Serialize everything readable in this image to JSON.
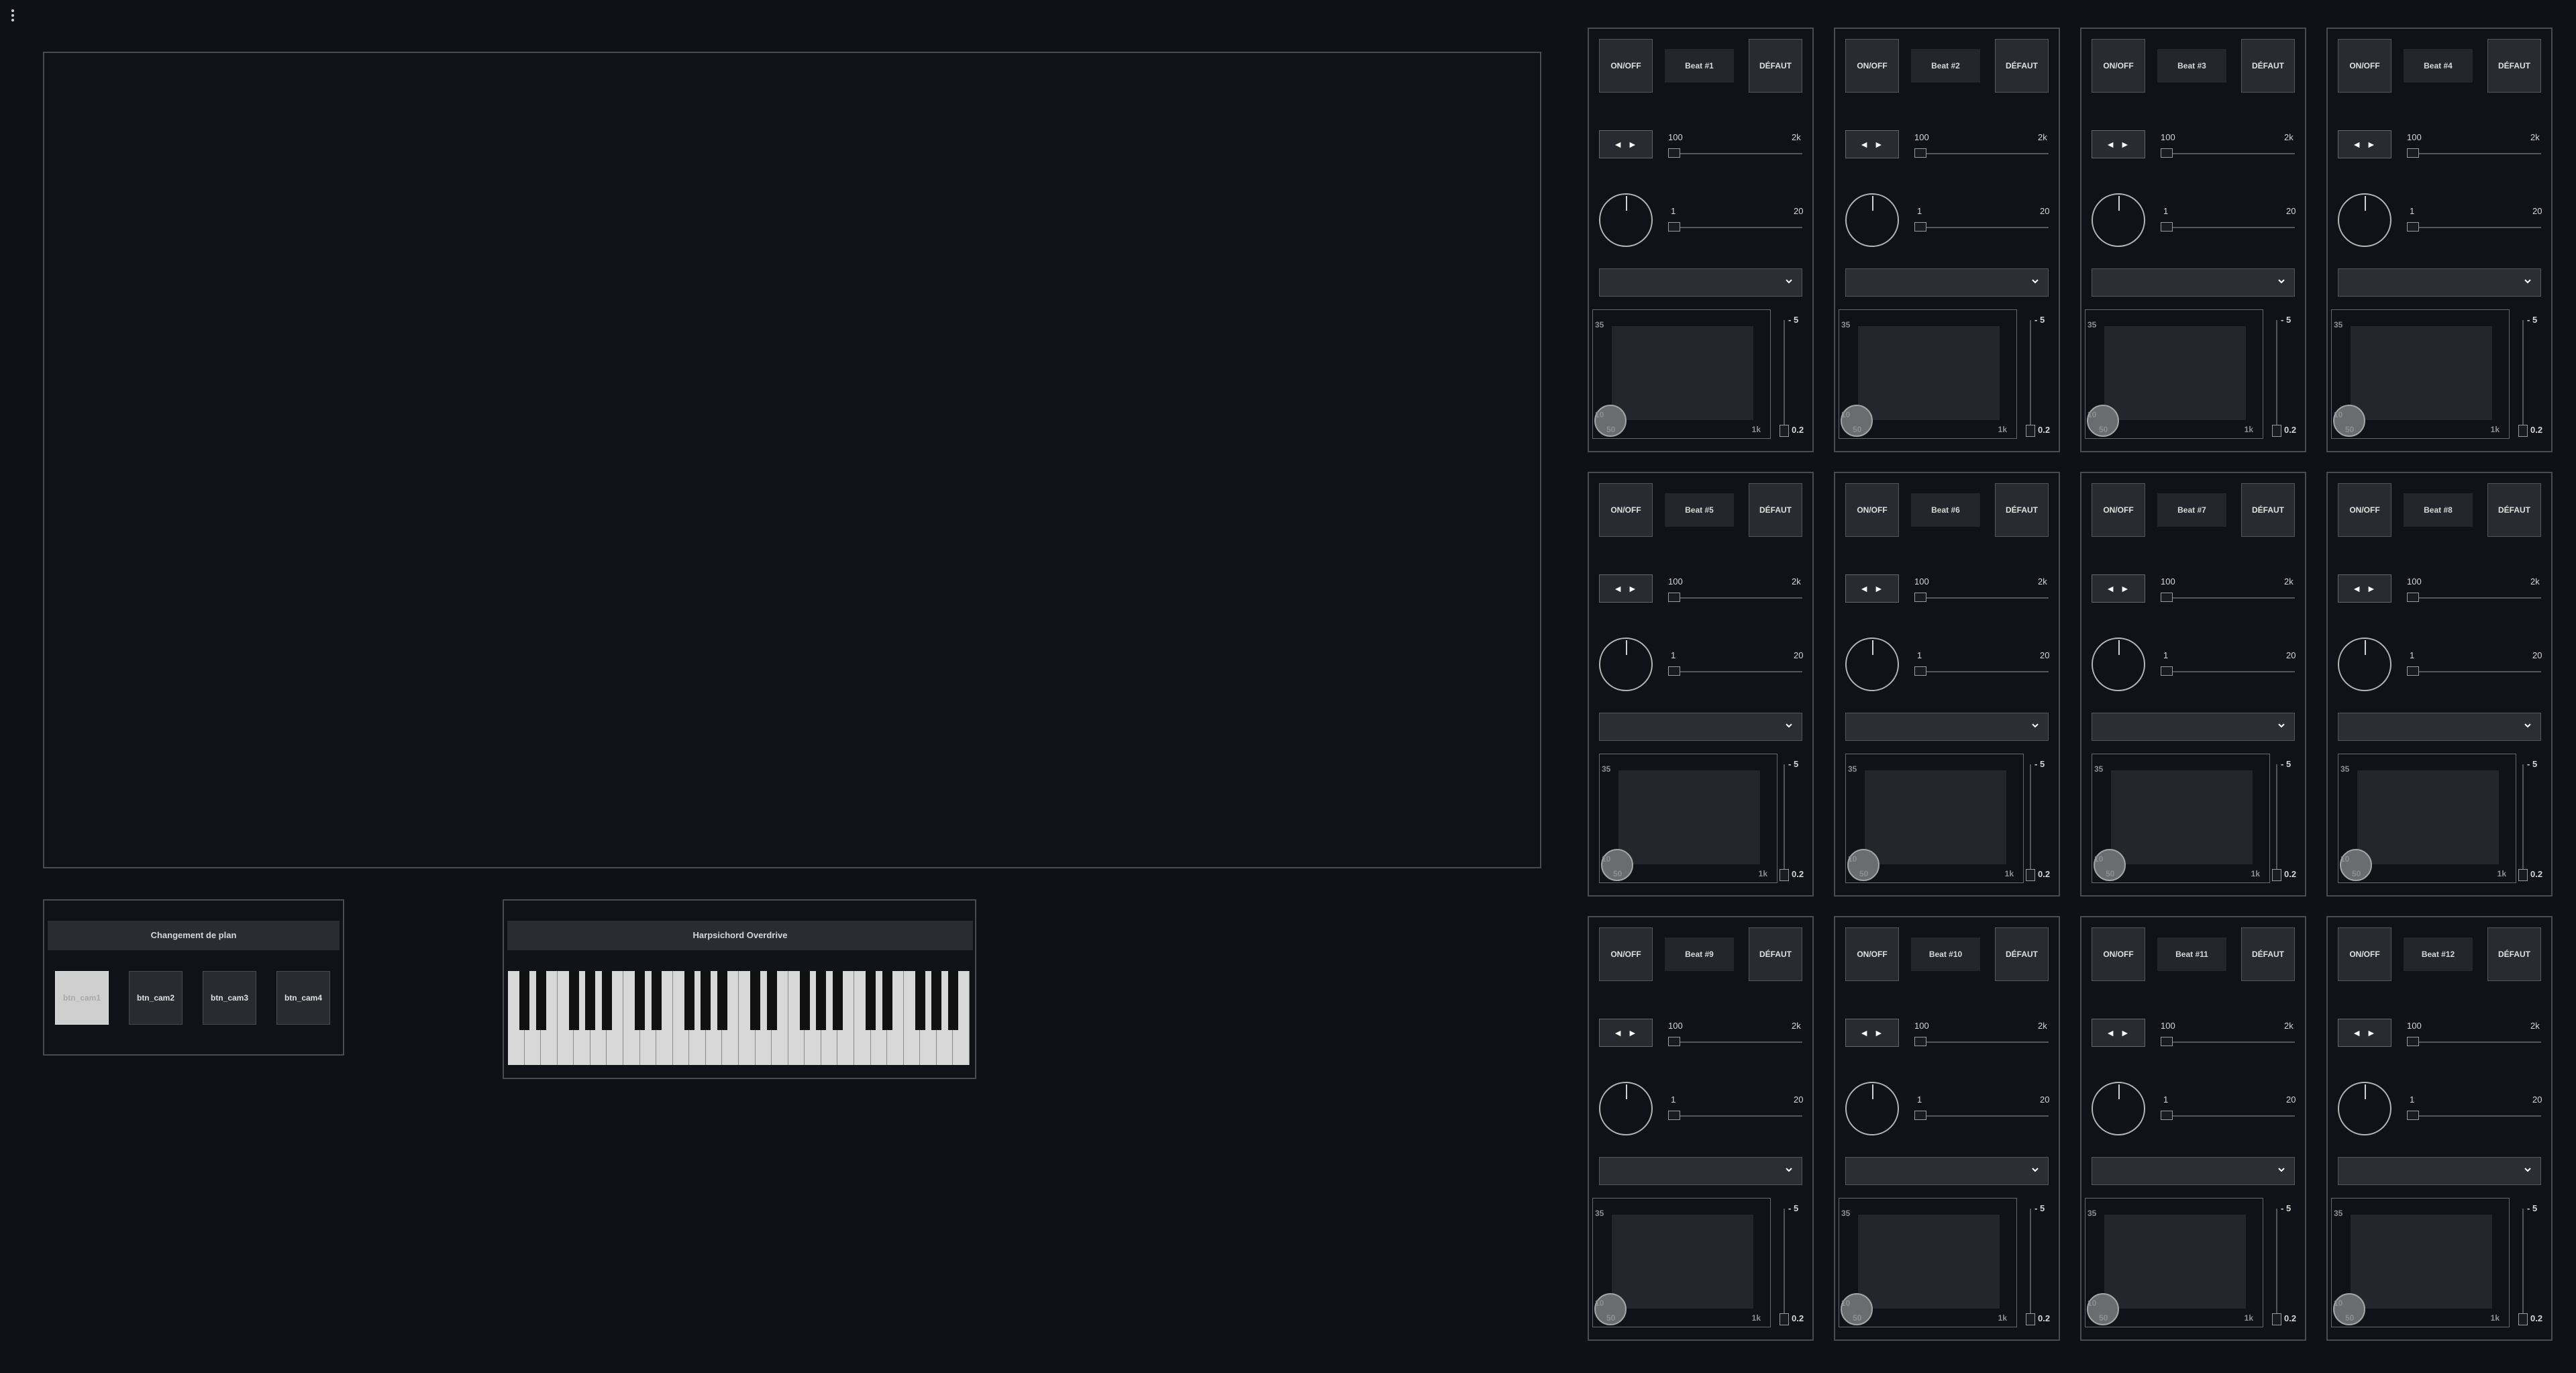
{
  "menu": {
    "icon": "more-vertical-icon"
  },
  "camera_panel": {
    "title": "Changement de plan",
    "buttons": [
      "btn_cam1",
      "btn_cam2",
      "btn_cam3",
      "btn_cam4"
    ],
    "active_index": 0
  },
  "instrument_panel": {
    "title": "Harpsichord Overdrive",
    "octaves": 4
  },
  "beats": [
    {
      "name": "Beat #1"
    },
    {
      "name": "Beat #2"
    },
    {
      "name": "Beat #3"
    },
    {
      "name": "Beat #4"
    },
    {
      "name": "Beat #5"
    },
    {
      "name": "Beat #6"
    },
    {
      "name": "Beat #7"
    },
    {
      "name": "Beat #8"
    },
    {
      "name": "Beat #9"
    },
    {
      "name": "Beat #10"
    },
    {
      "name": "Beat #11"
    },
    {
      "name": "Beat #12"
    }
  ],
  "beat_common": {
    "onoff_label": "ON/OFF",
    "default_label": "DÉFAUT",
    "direction_label": "◄ ►",
    "slider1_min": "100",
    "slider1_max": "2k",
    "slider2_min": "1",
    "slider2_max": "20",
    "pad_y_max": "35",
    "pad_y_min": "10",
    "pad_x_min": "50",
    "pad_x_max": "1k",
    "vslider_max": "5",
    "vslider_min": "0.2",
    "direction_icon": "left-right-arrows-icon",
    "knob_icon": "rotary-knob-icon",
    "dropdown_icon": "chevron-down-icon"
  }
}
